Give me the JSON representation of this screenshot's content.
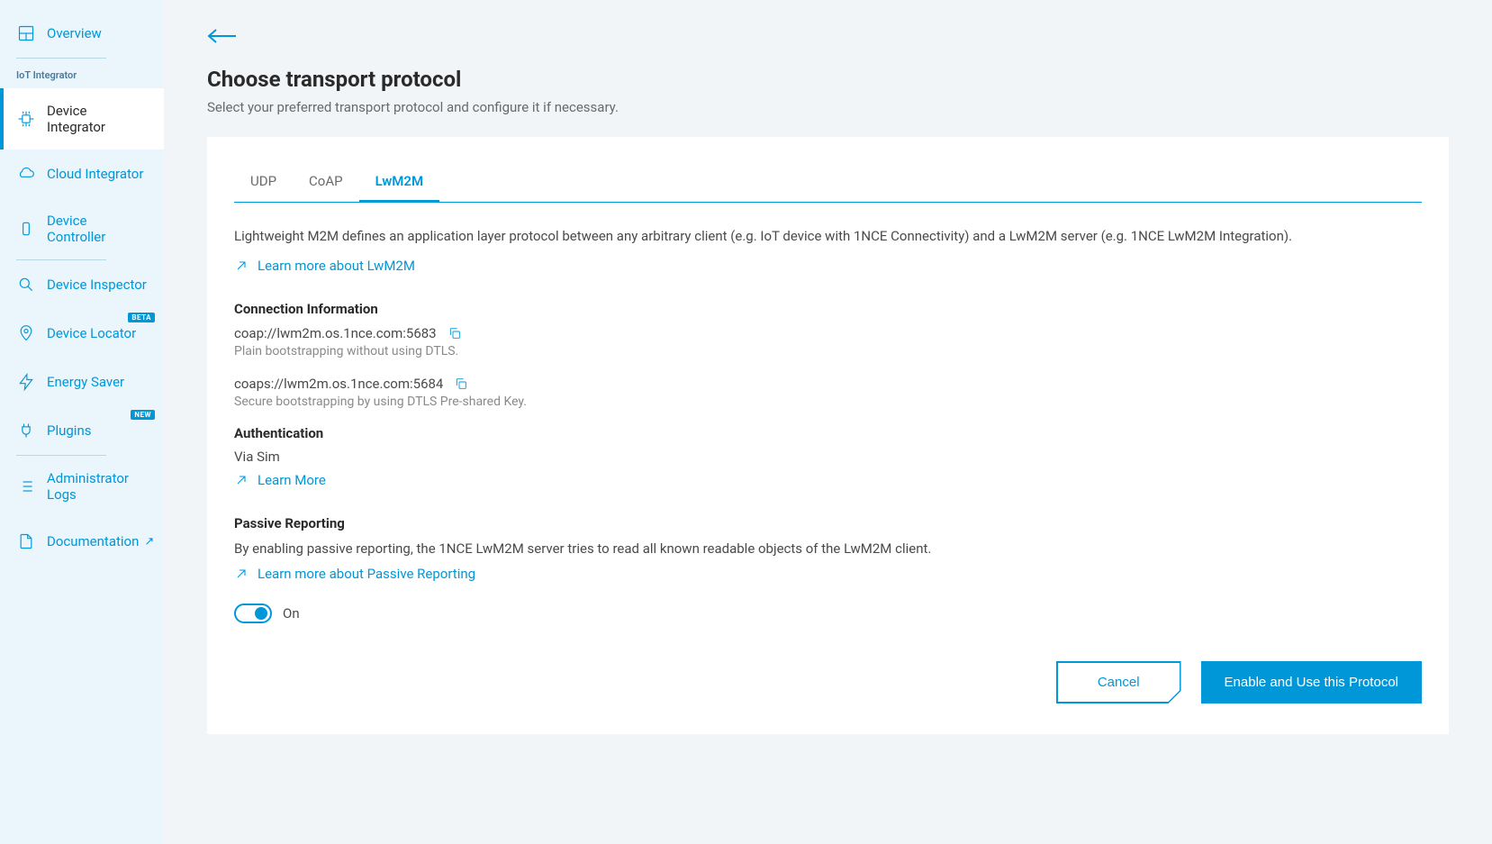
{
  "sidebar": {
    "overview": "Overview",
    "section_label": "IoT Integrator",
    "items": [
      {
        "label": "Device Integrator"
      },
      {
        "label": "Cloud Integrator"
      },
      {
        "label": "Device Controller"
      },
      {
        "label": "Device Inspector"
      },
      {
        "label": "Device Locator",
        "badge": "BETA"
      },
      {
        "label": "Energy Saver"
      },
      {
        "label": "Plugins",
        "badge": "NEW"
      },
      {
        "label": "Administrator Logs"
      },
      {
        "label": "Documentation"
      }
    ]
  },
  "page": {
    "title": "Choose transport protocol",
    "subtitle": "Select your preferred transport protocol and configure it if necessary."
  },
  "tabs": {
    "udp": "UDP",
    "coap": "CoAP",
    "lwm2m": "LwM2M"
  },
  "lwm2m": {
    "description": "Lightweight M2M defines an application layer protocol between any arbitrary client (e.g. IoT device with 1NCE Connectivity) and a LwM2M server (e.g. 1NCE LwM2M Integration).",
    "learn_link": "Learn more about LwM2M",
    "connection": {
      "heading": "Connection Information",
      "url1": "coap://lwm2m.os.1nce.com:5683",
      "desc1": "Plain bootstrapping without using DTLS.",
      "url2": "coaps://lwm2m.os.1nce.com:5684",
      "desc2": "Secure bootstrapping by using DTLS Pre-shared Key."
    },
    "auth": {
      "heading": "Authentication",
      "value": "Via Sim",
      "learn_link": "Learn More"
    },
    "passive": {
      "heading": "Passive Reporting",
      "description": "By enabling passive reporting, the 1NCE LwM2M server tries to read all known readable objects of the LwM2M client.",
      "learn_link": "Learn more about Passive Reporting",
      "toggle_label": "On"
    }
  },
  "footer": {
    "cancel": "Cancel",
    "enable": "Enable and Use this Protocol"
  }
}
